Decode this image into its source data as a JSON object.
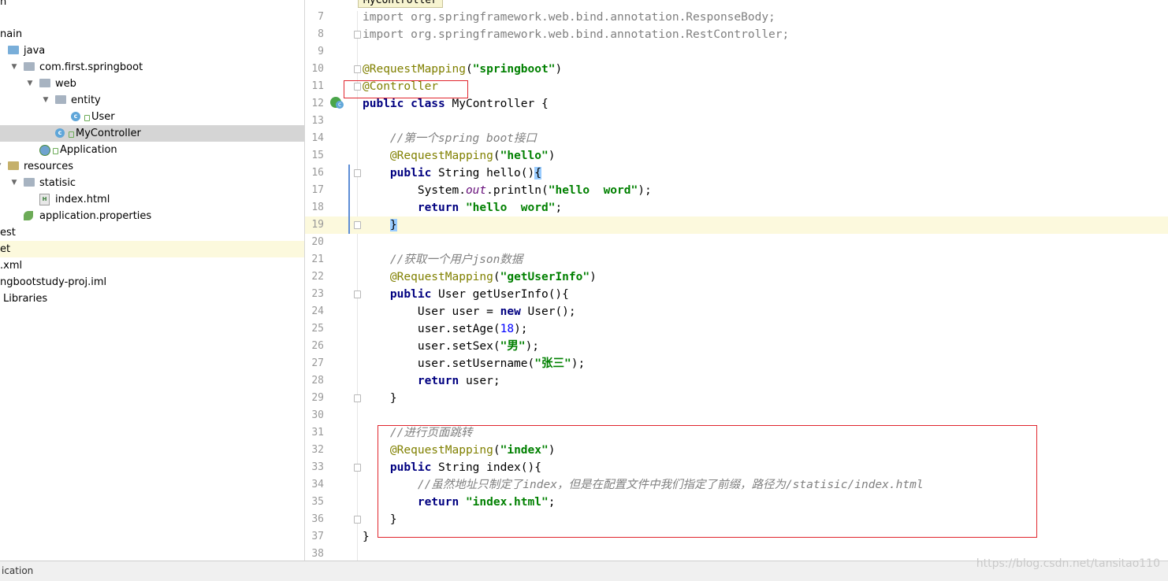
{
  "editor_tab": "MyController",
  "tree": [
    {
      "label": "n",
      "depth": -1
    },
    {
      "label": "nain",
      "depth": -1
    },
    {
      "label": "java",
      "depth": 0,
      "icon": "source-folder-icon"
    },
    {
      "label": "com.first.springboot",
      "depth": 1,
      "icon": "package-icon"
    },
    {
      "label": "web",
      "depth": 2,
      "icon": "package-icon"
    },
    {
      "label": "entity",
      "depth": 3,
      "icon": "package-icon"
    },
    {
      "label": "User",
      "depth": 4,
      "icon": "class-icon"
    },
    {
      "label": "MyController",
      "depth": 3,
      "icon": "class-icon",
      "selected": true
    },
    {
      "label": "Application",
      "depth": 2,
      "icon": "spring-boot-app-icon"
    },
    {
      "label": "resources",
      "depth": 0,
      "icon": "resources-folder-icon"
    },
    {
      "label": "statisic",
      "depth": 1,
      "icon": "folder-icon"
    },
    {
      "label": "index.html",
      "depth": 2,
      "icon": "html-file-icon"
    },
    {
      "label": "application.properties",
      "depth": 1,
      "icon": "spring-properties-icon"
    },
    {
      "label": "est",
      "depth": -1
    },
    {
      "label": "et",
      "depth": -1,
      "highlight": true
    },
    {
      "label": ".xml",
      "depth": -1
    },
    {
      "label": "ngbootstudy-proj.iml",
      "depth": -1
    },
    {
      "label": "Libraries",
      "depth": -1
    }
  ],
  "code": [
    {
      "n": "7",
      "parts": [
        [
          "grey",
          "import org.springframework.web.bind.annotation.ResponseBody;"
        ]
      ]
    },
    {
      "n": "8",
      "parts": [
        [
          "grey",
          "import org.springframework.web.bind.annotation.RestController;"
        ]
      ]
    },
    {
      "n": "9",
      "parts": []
    },
    {
      "n": "10",
      "parts": [
        [
          "ann",
          "@RequestMapping"
        ],
        [
          "",
          "("
        ],
        [
          "str",
          "\"springboot\""
        ],
        [
          "",
          ")"
        ]
      ]
    },
    {
      "n": "11",
      "parts": [
        [
          "ann",
          "@Controller"
        ]
      ]
    },
    {
      "n": "12",
      "parts": [
        [
          "kw",
          "public class "
        ],
        [
          "",
          "MyController {"
        ]
      ]
    },
    {
      "n": "13",
      "parts": []
    },
    {
      "n": "14",
      "parts": [
        [
          "",
          "    "
        ],
        [
          "cmt",
          "//第一个spring boot接口"
        ]
      ]
    },
    {
      "n": "15",
      "parts": [
        [
          "",
          "    "
        ],
        [
          "ann",
          "@RequestMapping"
        ],
        [
          "",
          "("
        ],
        [
          "str",
          "\"hello\""
        ],
        [
          "",
          ")"
        ]
      ]
    },
    {
      "n": "16",
      "parts": [
        [
          "",
          "    "
        ],
        [
          "kw",
          "public "
        ],
        [
          "",
          "String hello()"
        ],
        [
          "brace",
          "{"
        ]
      ]
    },
    {
      "n": "17",
      "parts": [
        [
          "",
          "        System."
        ],
        [
          "stat",
          "out"
        ],
        [
          "",
          ".println("
        ],
        [
          "str",
          "\"hello  word\""
        ],
        [
          "",
          ");"
        ]
      ]
    },
    {
      "n": "18",
      "parts": [
        [
          "",
          "        "
        ],
        [
          "kw",
          "return "
        ],
        [
          "str",
          "\"hello  word\""
        ],
        [
          "",
          ";"
        ]
      ]
    },
    {
      "n": "19",
      "parts": [
        [
          "",
          "    "
        ],
        [
          "brace",
          "}"
        ]
      ],
      "current": true
    },
    {
      "n": "20",
      "parts": []
    },
    {
      "n": "21",
      "parts": [
        [
          "",
          "    "
        ],
        [
          "cmt",
          "//获取一个用户json数据"
        ]
      ]
    },
    {
      "n": "22",
      "parts": [
        [
          "",
          "    "
        ],
        [
          "ann",
          "@RequestMapping"
        ],
        [
          "",
          "("
        ],
        [
          "str",
          "\"getUserInfo\""
        ],
        [
          "",
          ")"
        ]
      ]
    },
    {
      "n": "23",
      "parts": [
        [
          "",
          "    "
        ],
        [
          "kw",
          "public "
        ],
        [
          "",
          "User getUserInfo(){"
        ]
      ]
    },
    {
      "n": "24",
      "parts": [
        [
          "",
          "        User user = "
        ],
        [
          "kw",
          "new "
        ],
        [
          "",
          "User();"
        ]
      ]
    },
    {
      "n": "25",
      "parts": [
        [
          "",
          "        user.setAge("
        ],
        [
          "num",
          "18"
        ],
        [
          "",
          ");"
        ]
      ]
    },
    {
      "n": "26",
      "parts": [
        [
          "",
          "        user.setSex("
        ],
        [
          "str",
          "\"男\""
        ],
        [
          "",
          ");"
        ]
      ]
    },
    {
      "n": "27",
      "parts": [
        [
          "",
          "        user.setUsername("
        ],
        [
          "str",
          "\"张三\""
        ],
        [
          "",
          ");"
        ]
      ]
    },
    {
      "n": "28",
      "parts": [
        [
          "",
          "        "
        ],
        [
          "kw",
          "return "
        ],
        [
          "",
          "user;"
        ]
      ]
    },
    {
      "n": "29",
      "parts": [
        [
          "",
          "    }"
        ]
      ]
    },
    {
      "n": "30",
      "parts": []
    },
    {
      "n": "31",
      "parts": [
        [
          "",
          "    "
        ],
        [
          "cmt",
          "//进行页面跳转"
        ]
      ]
    },
    {
      "n": "32",
      "parts": [
        [
          "",
          "    "
        ],
        [
          "ann",
          "@RequestMapping"
        ],
        [
          "",
          "("
        ],
        [
          "str",
          "\"index\""
        ],
        [
          "",
          ")"
        ]
      ]
    },
    {
      "n": "33",
      "parts": [
        [
          "",
          "    "
        ],
        [
          "kw",
          "public "
        ],
        [
          "",
          "String index(){"
        ]
      ]
    },
    {
      "n": "34",
      "parts": [
        [
          "",
          "        "
        ],
        [
          "cmt",
          "//虽然地址只制定了index，但是在配置文件中我们指定了前缀，路径为/statisic/index.html"
        ]
      ]
    },
    {
      "n": "35",
      "parts": [
        [
          "",
          "        "
        ],
        [
          "kw",
          "return "
        ],
        [
          "str",
          "\"index.html\""
        ],
        [
          "",
          ";"
        ]
      ]
    },
    {
      "n": "36",
      "parts": [
        [
          "",
          "    }"
        ]
      ]
    },
    {
      "n": "37",
      "parts": [
        [
          "",
          "}"
        ]
      ]
    },
    {
      "n": "38",
      "parts": []
    }
  ],
  "status_text": "ication",
  "watermark": "https://blog.csdn.net/tansitao110",
  "colors": {
    "keyword": "#000080",
    "annotation": "#808000",
    "string": "#008000",
    "comment": "#808080",
    "highlight_box": "#e0262e",
    "current_line": "#fcf9dd"
  }
}
